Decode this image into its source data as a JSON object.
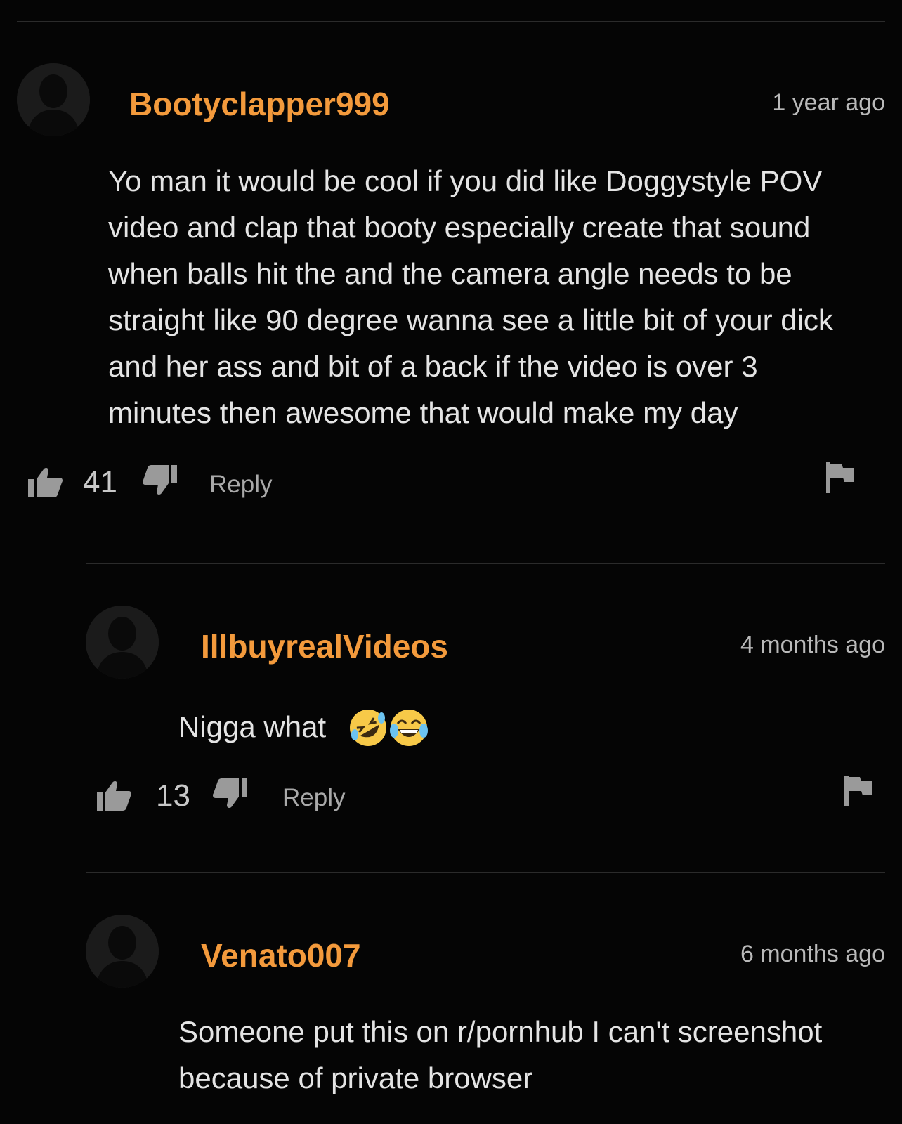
{
  "comments": [
    {
      "username": "Bootyclapper999",
      "time": "1 year ago",
      "text": "Yo man it would be cool if you did like Doggystyle POV video and clap that booty especially create that sound when balls hit the and the camera angle needs to be straight like 90 degree wanna see a little bit of your dick and her ass and bit of a back if the video is over 3 minutes then awesome that would make my day",
      "likes": "41",
      "reply_label": "Reply"
    },
    {
      "username": "IllbuyrealVideos",
      "time": "4 months ago",
      "text": "Nigga what",
      "emojis": [
        "rolling-on-floor-laughing-emoji",
        "tears-of-joy-emoji"
      ],
      "likes": "13",
      "reply_label": "Reply"
    },
    {
      "username": "Venato007",
      "time": "6 months ago",
      "text": "Someone put this on r/pornhub I can't screenshot because of private browser"
    }
  ],
  "colors": {
    "background": "#050505",
    "username": "#f39a3c",
    "divider": "#2b2b2b",
    "avatar_bg": "#1b1b1b",
    "icon": "#9a9a9a"
  }
}
